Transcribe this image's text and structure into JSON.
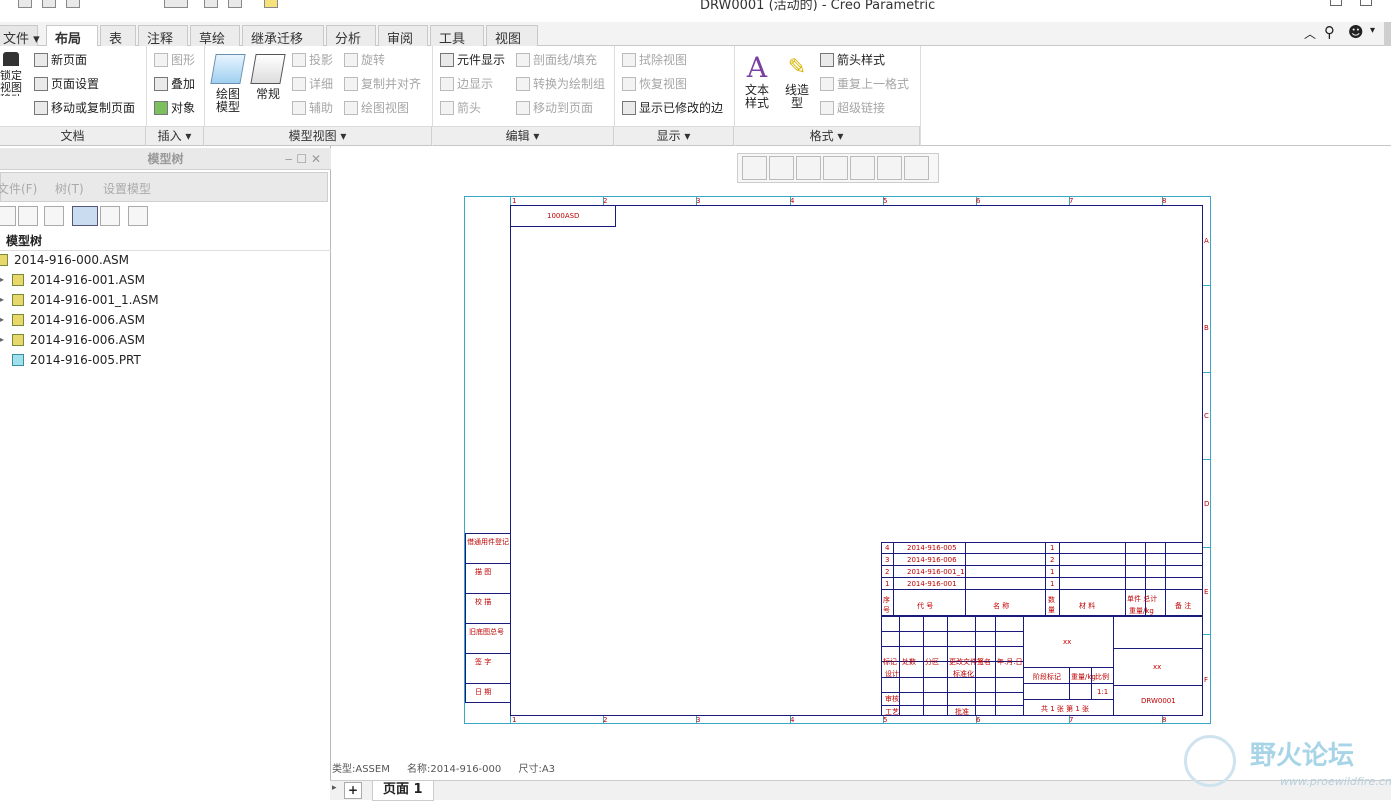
{
  "window": {
    "title": "DRW0001 (活动的) - Creo Parametric"
  },
  "tabs": [
    "文件",
    "布局",
    "表",
    "注释",
    "草绘",
    "继承迁移",
    "分析",
    "审阅",
    "工具",
    "视图"
  ],
  "active_tab": "布局",
  "ribbon": {
    "groups": {
      "doc": "文档",
      "insert": "插入",
      "model_views": "模型视图",
      "edit": "编辑",
      "display": "显示",
      "format": "格式"
    },
    "doc": {
      "lock_view": "锁定视图移动",
      "new_page": "新页面",
      "page_setup": "页面设置",
      "move_copy_page": "移动或复制页面"
    },
    "insert": {
      "graphics": "图形",
      "overlay": "叠加",
      "object": "对象"
    },
    "model_views": {
      "drawing_model": "绘图模型",
      "general": "常规",
      "projection": "投影",
      "detail": "详细",
      "auxiliary": "辅助",
      "revolve": "旋转",
      "copy_align": "复制并对齐",
      "drawing_view": "绘图视图"
    },
    "edit": {
      "component_display": "元件显示",
      "xhatch": "剖面线/填充",
      "edge_display": "边显示",
      "convert_group": "转换为绘制组",
      "arrow": "箭头",
      "move_to_page": "移动到页面"
    },
    "display": {
      "erase_view": "拭除视图",
      "resume_view": "恢复视图",
      "show_modified_edges": "显示已修改的边"
    },
    "format": {
      "text_style": "文本样式",
      "line_style": "线造型",
      "arrow_style": "箭头样式",
      "repeat_format": "重复上一格式",
      "hyperlink": "超级链接"
    }
  },
  "model_tree": {
    "title": "模型树",
    "menu": [
      "文件(F)",
      "树(T)",
      "设置模型"
    ],
    "label": "模型树",
    "items": [
      {
        "name": "2014-916-000.ASM",
        "type": "asm",
        "level": 0
      },
      {
        "name": "2014-916-001.ASM",
        "type": "asm",
        "level": 1
      },
      {
        "name": "2014-916-001_1.ASM",
        "type": "asm",
        "level": 1
      },
      {
        "name": "2014-916-006.ASM",
        "type": "asm",
        "level": 1
      },
      {
        "name": "2014-916-006.ASM",
        "type": "asm",
        "level": 1
      },
      {
        "name": "2014-916-005.PRT",
        "type": "prt",
        "level": 1
      }
    ]
  },
  "drawing": {
    "top_cols": [
      "1",
      "2",
      "3",
      "4",
      "5",
      "6",
      "7",
      "8"
    ],
    "side_rows": [
      "A",
      "B",
      "C",
      "D",
      "E",
      "F"
    ],
    "corner_code": "1000ASD",
    "left_strip": [
      "借通用件登记",
      "描 图",
      "校 描",
      "旧底图总号",
      "签 字",
      "日 期"
    ],
    "bom_rows": [
      {
        "no": "4",
        "code": "2014-916-005",
        "qty": "1"
      },
      {
        "no": "3",
        "code": "2014-916-006",
        "qty": "2"
      },
      {
        "no": "2",
        "code": "2014-916-001_1",
        "qty": "1"
      },
      {
        "no": "1",
        "code": "2014-916-001",
        "qty": "1"
      }
    ],
    "bom_header": [
      "序号",
      "代 号",
      "名 称",
      "数量",
      "材 料",
      "单件 总计",
      "重量/kg",
      "备 注"
    ],
    "title_block": {
      "name": "xx",
      "company": "xx",
      "drawing_no": "DRW0001",
      "scale": "1:1",
      "sheet_info": "共 1 张 第 1 张",
      "labels": [
        "标记",
        "处数",
        "分区",
        "更改文件号",
        "签名",
        "年.月.日",
        "设计",
        "标准化",
        "审核",
        "工艺",
        "批准",
        "阶段标记",
        "重量/kg",
        "比例"
      ]
    }
  },
  "status": {
    "type": "类型:ASSEM",
    "name": "名称:2014-916-000",
    "size": "尺寸:A3"
  },
  "page_tab": "页面 1",
  "watermark": {
    "cn": "野火论坛",
    "url": "www.proewildfire.cn"
  }
}
